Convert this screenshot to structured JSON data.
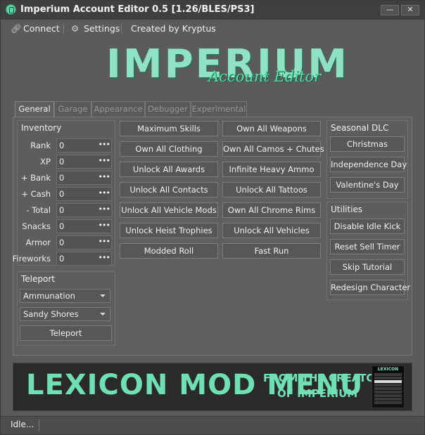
{
  "window": {
    "title": "Imperium Account Editor 0.5  [1.26/BLES/PS3]",
    "minimize": "—",
    "close": "✕"
  },
  "menu": {
    "connect": "Connect",
    "settings": "Settings",
    "credit": "Created by Kryptus"
  },
  "logo": {
    "main": "IMPERIUM",
    "sub": "Account Editor"
  },
  "tabs": [
    "General",
    "Garage",
    "Appearance",
    "Debugger",
    "Experimental"
  ],
  "inventory": {
    "title": "Inventory",
    "rows": [
      {
        "label": "Rank",
        "value": "0"
      },
      {
        "label": "XP",
        "value": "0"
      },
      {
        "label": "+ Bank",
        "value": "0"
      },
      {
        "label": "+ Cash",
        "value": "0"
      },
      {
        "label": "- Total",
        "value": "0"
      },
      {
        "label": "Snacks",
        "value": "0"
      },
      {
        "label": "Armor",
        "value": "0"
      },
      {
        "label": "Fireworks",
        "value": "0"
      }
    ],
    "dots": "•••"
  },
  "teleport": {
    "title": "Teleport",
    "location_a": "Ammunation",
    "location_b": "Sandy Shores",
    "button": "Teleport"
  },
  "actions_left": [
    "Maximum Skills",
    "Own All Clothing",
    "Unlock All Awards",
    "Unlock All Contacts",
    "Unlock All Vehicle Mods",
    "Unlock Heist Trophies",
    "Modded Roll"
  ],
  "actions_right": [
    "Own All Weapons",
    "Own All Camos + Chutes",
    "Infinite Heavy Ammo",
    "Unlock All Tattoos",
    "Own All Chrome Rims",
    "Unlock All Vehicles",
    "Fast Run"
  ],
  "seasonal": {
    "title": "Seasonal DLC",
    "buttons": [
      "Christmas",
      "Independence Day",
      "Valentine's Day"
    ]
  },
  "utilities": {
    "title": "Utilities",
    "buttons": [
      "Disable Idle Kick",
      "Reset Sell Timer",
      "Skip Tutorial",
      "Redesign Character"
    ]
  },
  "banner": {
    "main": "LEXICON MOD MENU",
    "sub1": "FROM THE CREATOR",
    "sub2": "OF IMPERIUM",
    "mini_title": "LEXICON"
  },
  "status": {
    "text": "Idle..."
  },
  "colors": {
    "accent": "#6fe0b4",
    "background": "#5b5b5b"
  }
}
